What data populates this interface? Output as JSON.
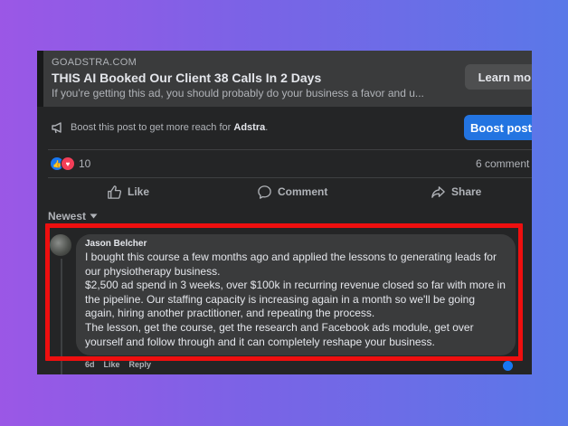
{
  "ad": {
    "domain": "GOADSTRA.COM",
    "title": "THIS AI Booked Our Client 38 Calls In 2 Days",
    "description": "If you're getting this ad, you should probably do your business a favor and u...",
    "cta_label": "Learn more"
  },
  "boost": {
    "text_prefix": "Boost this post to get more reach for ",
    "page_name": "Adstra",
    "text_suffix": ".",
    "button_label": "Boost post"
  },
  "stats": {
    "reaction_count": "10",
    "comments_label": "6 comment"
  },
  "actions": {
    "like": "Like",
    "comment": "Comment",
    "share": "Share"
  },
  "sort": {
    "label": "Newest"
  },
  "comment": {
    "author": "Jason Belcher",
    "paragraphs": [
      "I bought this course a few months ago and applied the lessons to generating leads for our physiotherapy business.",
      "$2,500 ad spend in 3 weeks, over $100k in recurring revenue closed so far with more in the pipeline. Our staffing capacity is increasing again in a month so we'll be going again, hiring another practitioner, and repeating the process.",
      "The lesson, get the course, get the research and Facebook ads module, get over yourself and follow through and it can completely reshape your business."
    ],
    "time": "6d",
    "like_label": "Like",
    "reply_label": "Reply"
  },
  "colors": {
    "panel_bg": "#242526",
    "accent_blue": "#2374e1",
    "highlight_red": "#ee0f0f"
  }
}
